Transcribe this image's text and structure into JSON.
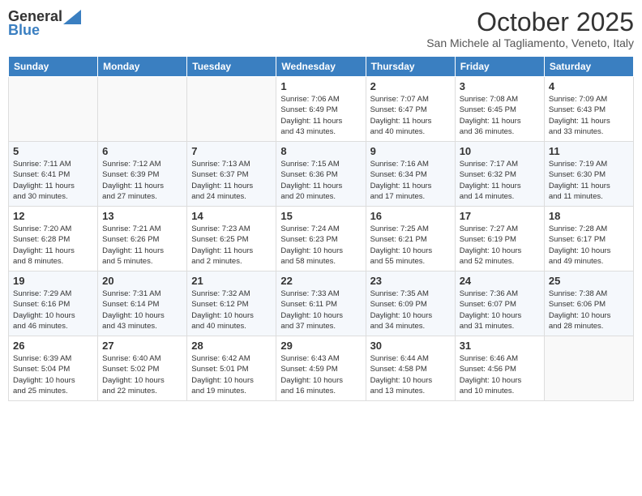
{
  "header": {
    "logo_general": "General",
    "logo_blue": "Blue",
    "month": "October 2025",
    "location": "San Michele al Tagliamento, Veneto, Italy"
  },
  "weekdays": [
    "Sunday",
    "Monday",
    "Tuesday",
    "Wednesday",
    "Thursday",
    "Friday",
    "Saturday"
  ],
  "weeks": [
    [
      {
        "day": "",
        "info": ""
      },
      {
        "day": "",
        "info": ""
      },
      {
        "day": "",
        "info": ""
      },
      {
        "day": "1",
        "info": "Sunrise: 7:06 AM\nSunset: 6:49 PM\nDaylight: 11 hours\nand 43 minutes."
      },
      {
        "day": "2",
        "info": "Sunrise: 7:07 AM\nSunset: 6:47 PM\nDaylight: 11 hours\nand 40 minutes."
      },
      {
        "day": "3",
        "info": "Sunrise: 7:08 AM\nSunset: 6:45 PM\nDaylight: 11 hours\nand 36 minutes."
      },
      {
        "day": "4",
        "info": "Sunrise: 7:09 AM\nSunset: 6:43 PM\nDaylight: 11 hours\nand 33 minutes."
      }
    ],
    [
      {
        "day": "5",
        "info": "Sunrise: 7:11 AM\nSunset: 6:41 PM\nDaylight: 11 hours\nand 30 minutes."
      },
      {
        "day": "6",
        "info": "Sunrise: 7:12 AM\nSunset: 6:39 PM\nDaylight: 11 hours\nand 27 minutes."
      },
      {
        "day": "7",
        "info": "Sunrise: 7:13 AM\nSunset: 6:37 PM\nDaylight: 11 hours\nand 24 minutes."
      },
      {
        "day": "8",
        "info": "Sunrise: 7:15 AM\nSunset: 6:36 PM\nDaylight: 11 hours\nand 20 minutes."
      },
      {
        "day": "9",
        "info": "Sunrise: 7:16 AM\nSunset: 6:34 PM\nDaylight: 11 hours\nand 17 minutes."
      },
      {
        "day": "10",
        "info": "Sunrise: 7:17 AM\nSunset: 6:32 PM\nDaylight: 11 hours\nand 14 minutes."
      },
      {
        "day": "11",
        "info": "Sunrise: 7:19 AM\nSunset: 6:30 PM\nDaylight: 11 hours\nand 11 minutes."
      }
    ],
    [
      {
        "day": "12",
        "info": "Sunrise: 7:20 AM\nSunset: 6:28 PM\nDaylight: 11 hours\nand 8 minutes."
      },
      {
        "day": "13",
        "info": "Sunrise: 7:21 AM\nSunset: 6:26 PM\nDaylight: 11 hours\nand 5 minutes."
      },
      {
        "day": "14",
        "info": "Sunrise: 7:23 AM\nSunset: 6:25 PM\nDaylight: 11 hours\nand 2 minutes."
      },
      {
        "day": "15",
        "info": "Sunrise: 7:24 AM\nSunset: 6:23 PM\nDaylight: 10 hours\nand 58 minutes."
      },
      {
        "day": "16",
        "info": "Sunrise: 7:25 AM\nSunset: 6:21 PM\nDaylight: 10 hours\nand 55 minutes."
      },
      {
        "day": "17",
        "info": "Sunrise: 7:27 AM\nSunset: 6:19 PM\nDaylight: 10 hours\nand 52 minutes."
      },
      {
        "day": "18",
        "info": "Sunrise: 7:28 AM\nSunset: 6:17 PM\nDaylight: 10 hours\nand 49 minutes."
      }
    ],
    [
      {
        "day": "19",
        "info": "Sunrise: 7:29 AM\nSunset: 6:16 PM\nDaylight: 10 hours\nand 46 minutes."
      },
      {
        "day": "20",
        "info": "Sunrise: 7:31 AM\nSunset: 6:14 PM\nDaylight: 10 hours\nand 43 minutes."
      },
      {
        "day": "21",
        "info": "Sunrise: 7:32 AM\nSunset: 6:12 PM\nDaylight: 10 hours\nand 40 minutes."
      },
      {
        "day": "22",
        "info": "Sunrise: 7:33 AM\nSunset: 6:11 PM\nDaylight: 10 hours\nand 37 minutes."
      },
      {
        "day": "23",
        "info": "Sunrise: 7:35 AM\nSunset: 6:09 PM\nDaylight: 10 hours\nand 34 minutes."
      },
      {
        "day": "24",
        "info": "Sunrise: 7:36 AM\nSunset: 6:07 PM\nDaylight: 10 hours\nand 31 minutes."
      },
      {
        "day": "25",
        "info": "Sunrise: 7:38 AM\nSunset: 6:06 PM\nDaylight: 10 hours\nand 28 minutes."
      }
    ],
    [
      {
        "day": "26",
        "info": "Sunrise: 6:39 AM\nSunset: 5:04 PM\nDaylight: 10 hours\nand 25 minutes."
      },
      {
        "day": "27",
        "info": "Sunrise: 6:40 AM\nSunset: 5:02 PM\nDaylight: 10 hours\nand 22 minutes."
      },
      {
        "day": "28",
        "info": "Sunrise: 6:42 AM\nSunset: 5:01 PM\nDaylight: 10 hours\nand 19 minutes."
      },
      {
        "day": "29",
        "info": "Sunrise: 6:43 AM\nSunset: 4:59 PM\nDaylight: 10 hours\nand 16 minutes."
      },
      {
        "day": "30",
        "info": "Sunrise: 6:44 AM\nSunset: 4:58 PM\nDaylight: 10 hours\nand 13 minutes."
      },
      {
        "day": "31",
        "info": "Sunrise: 6:46 AM\nSunset: 4:56 PM\nDaylight: 10 hours\nand 10 minutes."
      },
      {
        "day": "",
        "info": ""
      }
    ]
  ]
}
